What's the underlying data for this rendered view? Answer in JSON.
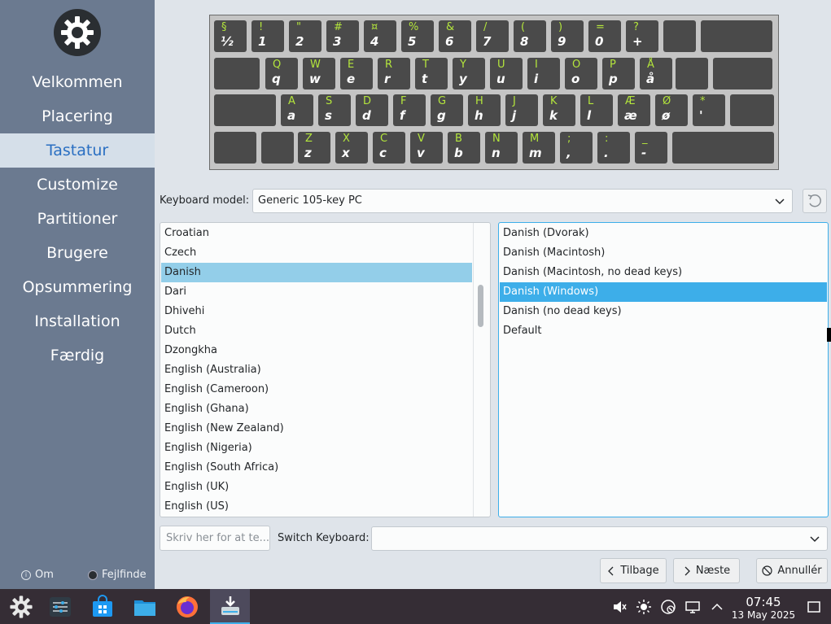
{
  "sidebar": {
    "steps": [
      "Velkommen",
      "Placering",
      "Tastatur",
      "Customize",
      "Partitioner",
      "Brugere",
      "Opsummering",
      "Installation",
      "Færdig"
    ],
    "active_step": "Tastatur",
    "about_label": "Om",
    "debug_label": "Fejlfinde"
  },
  "keyboard_preview": {
    "rows": [
      [
        [
          "§",
          "½"
        ],
        [
          "!",
          "1"
        ],
        [
          "\"",
          "2"
        ],
        [
          "#",
          "3"
        ],
        [
          "¤",
          "4"
        ],
        [
          "%",
          "5"
        ],
        [
          "&",
          "6"
        ],
        [
          "/",
          "7"
        ],
        [
          "(",
          "8"
        ],
        [
          ")",
          "9"
        ],
        [
          "=",
          "0"
        ],
        [
          "?",
          "+"
        ],
        [
          "",
          ""
        ],
        [
          "",
          ""
        ]
      ],
      [
        [
          "",
          ""
        ],
        [
          "Q",
          "q"
        ],
        [
          "W",
          "w"
        ],
        [
          "E",
          "e"
        ],
        [
          "R",
          "r"
        ],
        [
          "T",
          "t"
        ],
        [
          "Y",
          "y"
        ],
        [
          "U",
          "u"
        ],
        [
          "I",
          "i"
        ],
        [
          "O",
          "o"
        ],
        [
          "P",
          "p"
        ],
        [
          "Å",
          "å"
        ],
        [
          "",
          ""
        ],
        [
          "",
          ""
        ]
      ],
      [
        [
          "",
          ""
        ],
        [
          "A",
          "a"
        ],
        [
          "S",
          "s"
        ],
        [
          "D",
          "d"
        ],
        [
          "F",
          "f"
        ],
        [
          "G",
          "g"
        ],
        [
          "H",
          "h"
        ],
        [
          "J",
          "j"
        ],
        [
          "K",
          "k"
        ],
        [
          "L",
          "l"
        ],
        [
          "Æ",
          "æ"
        ],
        [
          "Ø",
          "ø"
        ],
        [
          "*",
          "'"
        ],
        [
          "",
          ""
        ]
      ],
      [
        [
          "",
          ""
        ],
        [
          "",
          ""
        ],
        [
          "Z",
          "z"
        ],
        [
          "X",
          "x"
        ],
        [
          "C",
          "c"
        ],
        [
          "V",
          "v"
        ],
        [
          "B",
          "b"
        ],
        [
          "N",
          "n"
        ],
        [
          "M",
          "m"
        ],
        [
          ";",
          ","
        ],
        [
          ":",
          "."
        ],
        [
          "_",
          "-"
        ],
        [
          "",
          ""
        ]
      ]
    ]
  },
  "keyboard_model": {
    "label": "Keyboard model:",
    "value": "Generic 105-key PC"
  },
  "layouts": {
    "items": [
      "Croatian",
      "Czech",
      "Danish",
      "Dari",
      "Dhivehi",
      "Dutch",
      "Dzongkha",
      "English (Australia)",
      "English (Cameroon)",
      "English (Ghana)",
      "English (New Zealand)",
      "English (Nigeria)",
      "English (South Africa)",
      "English (UK)",
      "English (US)"
    ],
    "selected": "Danish"
  },
  "variants": {
    "items": [
      "Danish (Dvorak)",
      "Danish (Macintosh)",
      "Danish (Macintosh, no dead keys)",
      "Danish (Windows)",
      "Danish (no dead keys)",
      "Default"
    ],
    "selected": "Danish (Windows)"
  },
  "test_input": {
    "placeholder": "Skriv her for at te..."
  },
  "switch_keyboard": {
    "label": "Switch Keyboard:",
    "value": ""
  },
  "buttons": {
    "back": "Tilbage",
    "next": "Næste",
    "cancel": "Annullér"
  },
  "taskbar": {
    "apps": [
      "launcher-icon",
      "system-settings-icon",
      "discover-store-icon",
      "file-manager-icon",
      "firefox-icon",
      "installer-icon"
    ],
    "tray": [
      "volume-muted-icon",
      "brightness-icon",
      "network-icon",
      "display-icon",
      "tray-expand-icon"
    ],
    "time": "07:45",
    "date": "13 May 2025"
  },
  "colors": {
    "accent": "#3daee9",
    "sidebar": "#6b7a90",
    "active_step_text": "#2a6fc2",
    "key_shift_label": "#b4e63c",
    "taskbar": "#352d35"
  }
}
